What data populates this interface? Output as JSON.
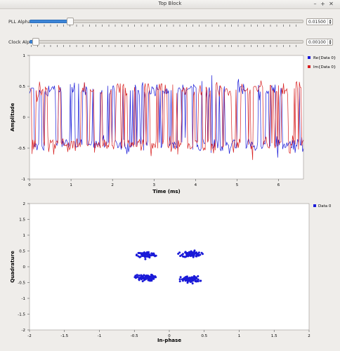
{
  "window": {
    "title": "Top Block",
    "min_icon": "minimize-icon",
    "max_icon": "maximize-icon",
    "close_icon": "close-icon"
  },
  "controls": {
    "pll": {
      "label": "PLL Alpha",
      "value": "0.01500",
      "fraction": 0.14
    },
    "clock": {
      "label": "Clock Alpha",
      "value": "0.00100",
      "fraction": 0.01
    }
  },
  "time_plot": {
    "legend": [
      {
        "label": "Re{Data 0}",
        "color": "#1a1ad8"
      },
      {
        "label": "Im{Data 0}",
        "color": "#d82020"
      }
    ]
  },
  "const_plot": {
    "legend": [
      {
        "label": "Data 0",
        "color": "#1a1ad8"
      }
    ]
  },
  "chart_data": [
    {
      "type": "line",
      "xlabel": "Time (ms)",
      "ylabel": "Amplitude",
      "xlim": [
        0,
        6.6
      ],
      "ylim": [
        -1,
        1
      ],
      "xticks": [
        "0",
        "1",
        "2",
        "3",
        "4",
        "5",
        "6"
      ],
      "yticks": [
        "1",
        "0.5",
        "0",
        "-0.5",
        "-1"
      ],
      "grid": false,
      "legend_position": "top-right",
      "series": [
        {
          "name": "Re{Data 0}",
          "color": "#1a1ad8",
          "levels": [
            -0.45,
            0.45
          ],
          "spread": 0.06
        },
        {
          "name": "Im{Data 0}",
          "color": "#d82020",
          "levels": [
            -0.45,
            0.45
          ],
          "spread": 0.06
        }
      ]
    },
    {
      "type": "scatter",
      "xlabel": "In-phase",
      "ylabel": "Quadrature",
      "xlim": [
        -2,
        2
      ],
      "ylim": [
        -2,
        2
      ],
      "xticks": [
        "-2",
        "-1.5",
        "-1",
        "-0.5",
        "0",
        "0.5",
        "1",
        "1.5",
        "2"
      ],
      "yticks": [
        "2",
        "1.5",
        "1",
        "0.5",
        "0",
        "-0.5",
        "-1",
        "-1.5",
        "-2"
      ],
      "grid": false,
      "legend_position": "top-right",
      "series": [
        {
          "name": "Data 0",
          "color": "#1a1ad8",
          "clusters": [
            {
              "x": -0.33,
              "y": 0.38
            },
            {
              "x": 0.32,
              "y": 0.4
            },
            {
              "x": -0.35,
              "y": -0.35
            },
            {
              "x": 0.3,
              "y": -0.4
            }
          ],
          "cluster_spread": [
            0.11,
            0.06
          ]
        }
      ]
    }
  ]
}
